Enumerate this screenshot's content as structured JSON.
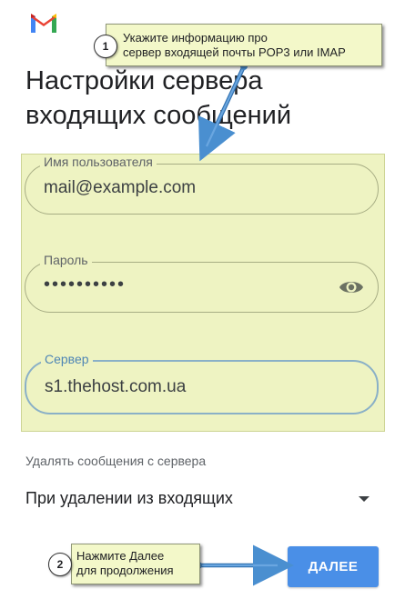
{
  "header": {
    "logo_icon": "gmail-logo-icon"
  },
  "page": {
    "title": "Настройки сервера\nвходящих сообщений"
  },
  "form": {
    "username": {
      "label": "Имя пользователя",
      "value": "mail@example.com"
    },
    "password": {
      "label": "Пароль",
      "value": "••••••••••",
      "toggle_icon": "eye-icon"
    },
    "server": {
      "label": "Сервер",
      "value": "s1.thehost.com.ua"
    },
    "delete": {
      "label": "Удалять сообщения с сервера",
      "selected": "При удалении из входящих"
    }
  },
  "actions": {
    "next_label": "ДАЛЕЕ"
  },
  "annotations": {
    "callout1": {
      "number": "1",
      "text": "Укажите информацию про\nсервер входящей почты POP3 или IMAP"
    },
    "callout2": {
      "number": "2",
      "text": "Нажмите Далее\nдля продолжения"
    }
  },
  "colors": {
    "highlight": "#eef3c2",
    "button": "#4a8fe7",
    "arrow": "#4a8fd0",
    "active_border": "#8ab0c7"
  }
}
